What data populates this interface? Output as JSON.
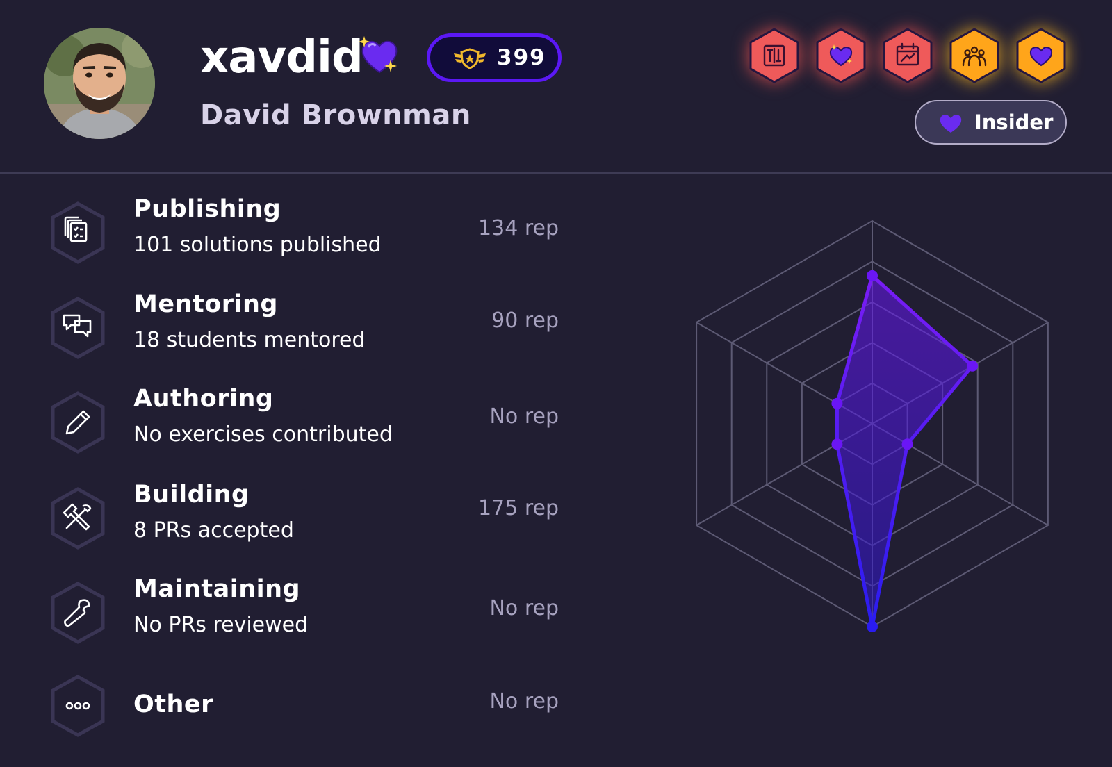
{
  "profile": {
    "handle": "xavdid",
    "name": "David Brownman",
    "reputation": "399",
    "status_badge": "Insider",
    "handle_icon": "sparkling-heart-icon",
    "avatar": "user-avatar-photo"
  },
  "badges": [
    {
      "icon": "tools-icon",
      "tier": "red"
    },
    {
      "icon": "heart-icon",
      "tier": "red"
    },
    {
      "icon": "calendar-icon",
      "tier": "red"
    },
    {
      "icon": "crowd-icon",
      "tier": "gold"
    },
    {
      "icon": "purple-heart-icon",
      "tier": "gold"
    }
  ],
  "categories": [
    {
      "title": "Publishing",
      "subtitle": "101 solutions published",
      "rep": "134 rep",
      "icon": "documents-icon"
    },
    {
      "title": "Mentoring",
      "subtitle": "18 students mentored",
      "rep": "90 rep",
      "icon": "chat-bubbles-icon"
    },
    {
      "title": "Authoring",
      "subtitle": "No exercises contributed",
      "rep": "No rep",
      "icon": "pencil-icon"
    },
    {
      "title": "Building",
      "subtitle": "8 PRs accepted",
      "rep": "175 rep",
      "icon": "tools-icon"
    },
    {
      "title": "Maintaining",
      "subtitle": "No PRs reviewed",
      "rep": "No rep",
      "icon": "wrench-icon"
    },
    {
      "title": "Other",
      "subtitle": "",
      "rep": "No rep",
      "icon": "more-icon"
    }
  ],
  "chart_data": {
    "type": "radar",
    "axes": [
      "top",
      "upper-right",
      "lower-right",
      "bottom",
      "lower-left",
      "upper-left"
    ],
    "values": [
      0.73,
      0.57,
      0.2,
      1.0,
      0.2,
      0.2
    ],
    "rings": 5,
    "color_line": "#6a16f5",
    "color_fill": "#4a1c9e"
  },
  "colors": {
    "background": "#211e32",
    "accent": "#5b18f5",
    "badge_red": "#ef5a5a",
    "badge_gold": "#ffa51a",
    "muted_text": "#a7a2bf"
  }
}
